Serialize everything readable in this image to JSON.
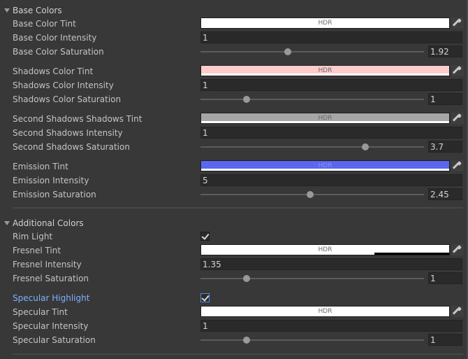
{
  "sections": {
    "base": {
      "title": "Base Colors",
      "tint_label": "Base Color Tint",
      "tint_color": "#ffffff",
      "tint_hdr": "HDR",
      "intensity_label": "Base Color Intensity",
      "intensity_value": "1",
      "saturation_label": "Base Color Saturation",
      "saturation_value": "1.92",
      "saturation_fraction": 0.39
    },
    "shadows": {
      "tint_label": "Shadows Color Tint",
      "tint_color": "#ffcccc",
      "tint_hdr": "HDR",
      "intensity_label": "Shadows Color Intensity",
      "intensity_value": "1",
      "saturation_label": "Shadows Color Saturation",
      "saturation_value": "1",
      "saturation_fraction": 0.206
    },
    "second_shadows": {
      "tint_label": "Second Shadows Shadows Tint",
      "tint_color": "#a6a6a6",
      "tint_hdr": "HDR",
      "intensity_label": "Second Shadows Intensity",
      "intensity_value": "1",
      "saturation_label": "Second Shadows Saturation",
      "saturation_value": "3.7",
      "saturation_fraction": 0.738
    },
    "emission": {
      "tint_label": "Emission Tint",
      "tint_color": "#5a67ee",
      "tint_hdr": "HDR",
      "intensity_label": "Emission Intensity",
      "intensity_value": "5",
      "saturation_label": "Emission Saturation",
      "saturation_value": "2.45",
      "saturation_fraction": 0.49
    },
    "additional": {
      "title": "Additional Colors",
      "rim_label": "Rim Light",
      "rim_checked": true,
      "fresnel_tint_label": "Fresnel Tint",
      "fresnel_tint_color": "#ffffff",
      "fresnel_tint_hdr": "HDR",
      "fresnel_intensity_label": "Fresnel Intensity",
      "fresnel_intensity_value": "1.35",
      "fresnel_saturation_label": "Fresnel Saturation",
      "fresnel_saturation_value": "1",
      "fresnel_saturation_fraction": 0.206,
      "specular_highlight_label": "Specular Highlight",
      "specular_highlight_checked": true,
      "specular_tint_label": "Specular Tint",
      "specular_tint_color": "#ffffff",
      "specular_tint_hdr": "HDR",
      "specular_intensity_label": "Specular Intensity",
      "specular_intensity_value": "1",
      "specular_saturation_label": "Specular Saturation",
      "specular_saturation_value": "1",
      "specular_saturation_fraction": 0.206
    }
  },
  "icons": {
    "foldout": "triangle-down-icon",
    "picker": "eyedropper-icon",
    "check": "checkmark-icon"
  },
  "colors": {
    "background": "#383838",
    "label": "#c4c4c4",
    "highlight_label": "#7fb0ff"
  }
}
